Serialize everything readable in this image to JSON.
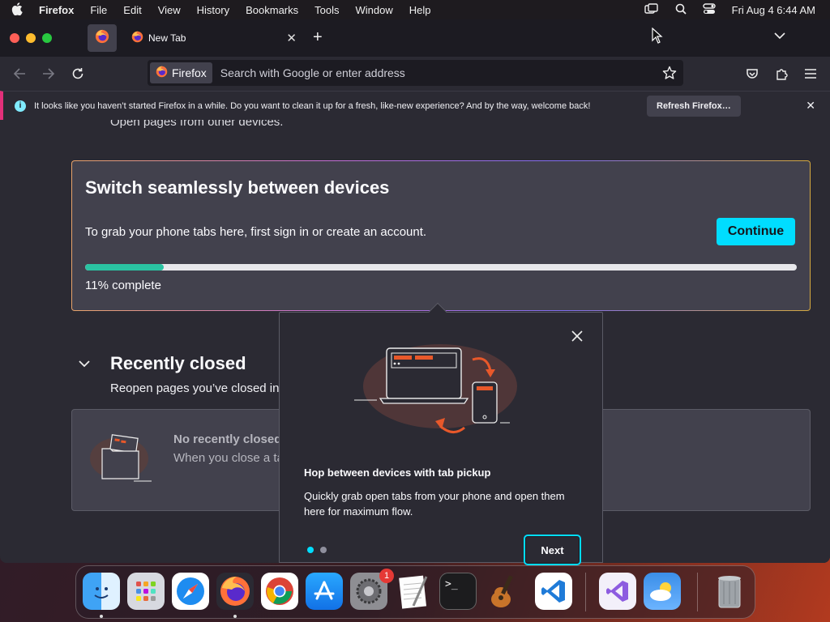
{
  "menubar": {
    "app": "Firefox",
    "items": [
      "File",
      "Edit",
      "View",
      "History",
      "Bookmarks",
      "Tools",
      "Window",
      "Help"
    ],
    "clock": "Fri Aug 4  6:44 AM"
  },
  "tabs": {
    "active_label": "New Tab"
  },
  "urlbar": {
    "identity": "Firefox",
    "placeholder": "Search with Google or enter address"
  },
  "infobar": {
    "message": "It looks like you haven’t started Firefox in a while. Do you want to clean it up for a fresh, like-new experience? And by the way, welcome back!",
    "button": "Refresh Firefox…"
  },
  "content": {
    "cut_off_text": "Open pages from other devices.",
    "sync_card": {
      "title": "Switch seamlessly between devices",
      "body": "To grab your phone tabs here, first sign in or create an account.",
      "button": "Continue",
      "progress": 0.11,
      "progress_label": "11% complete"
    },
    "recently_closed": {
      "title": "Recently closed",
      "subtitle": "Reopen pages you’ve closed in this window",
      "empty_title": "No recently closed tabs",
      "empty_body": "When you close a tab, you can fetch it from here."
    }
  },
  "popup": {
    "title": "Hop between devices with tab pickup",
    "body": "Quickly grab open tabs from your phone and open them here for maximum flow.",
    "button": "Next",
    "page": 1,
    "pages": 2
  },
  "dock": {
    "apps": [
      "finder-icon",
      "launchpad-icon",
      "safari-icon",
      "firefox-icon",
      "chrome-icon",
      "app-store-icon",
      "system-settings-icon",
      "textedit-icon",
      "terminal-icon",
      "garageband-icon",
      "vscode-icon",
      "visual-studio-icon",
      "weather-icon",
      "trash-icon"
    ],
    "settings_badge": "1"
  },
  "colors": {
    "accent": "#00ddff",
    "progress": "#2ac3a2",
    "infobar_stripe": "#e3307a",
    "illustration": "#e8582a"
  }
}
